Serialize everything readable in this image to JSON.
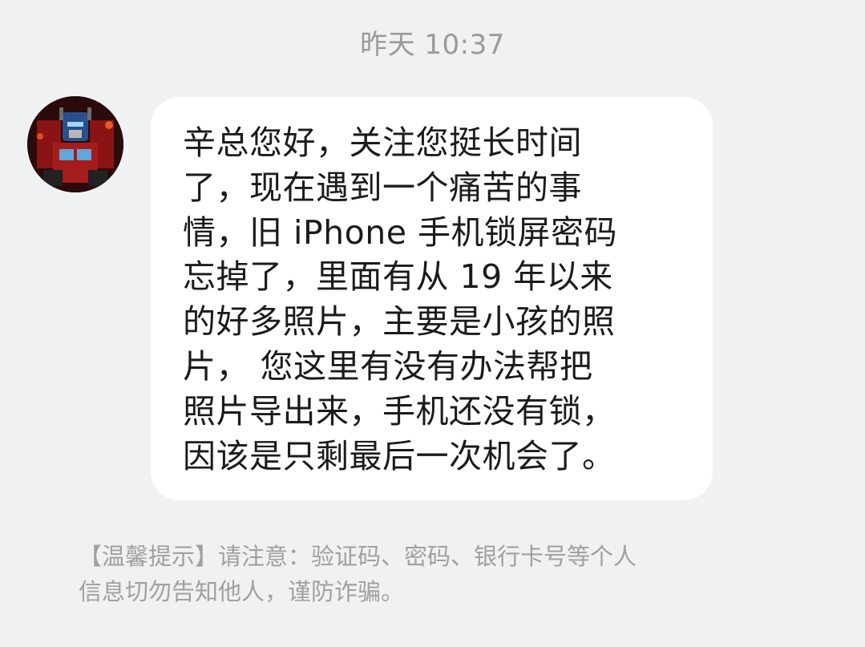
{
  "timestamp": "昨天 10:37",
  "message": {
    "lines": [
      "辛总您好，关注您挺长时间",
      "了，现在遇到一个痛苦的事",
      "情，旧 iPhone 手机锁屏密码",
      "忘掉了，里面有从 19 年以来",
      "的好多照片，主要是小孩的照",
      "片， 您这里有没有办法帮把",
      "照片导出来，手机还没有锁，",
      "因该是只剩最后一次机会了。"
    ]
  },
  "tip": {
    "lines": [
      "【温馨提示】请注意：验证码、密码、银行卡号等个人",
      "信息切勿告知他人，谨防诈骗。"
    ]
  },
  "avatar_icon": "robot-avatar-icon",
  "colors": {
    "background": "#f0f1f3",
    "bubble": "#ffffff",
    "message_text": "#1b1b1b",
    "tip_text": "#a0a0a0",
    "timestamp_text": "#9a9a9a"
  }
}
